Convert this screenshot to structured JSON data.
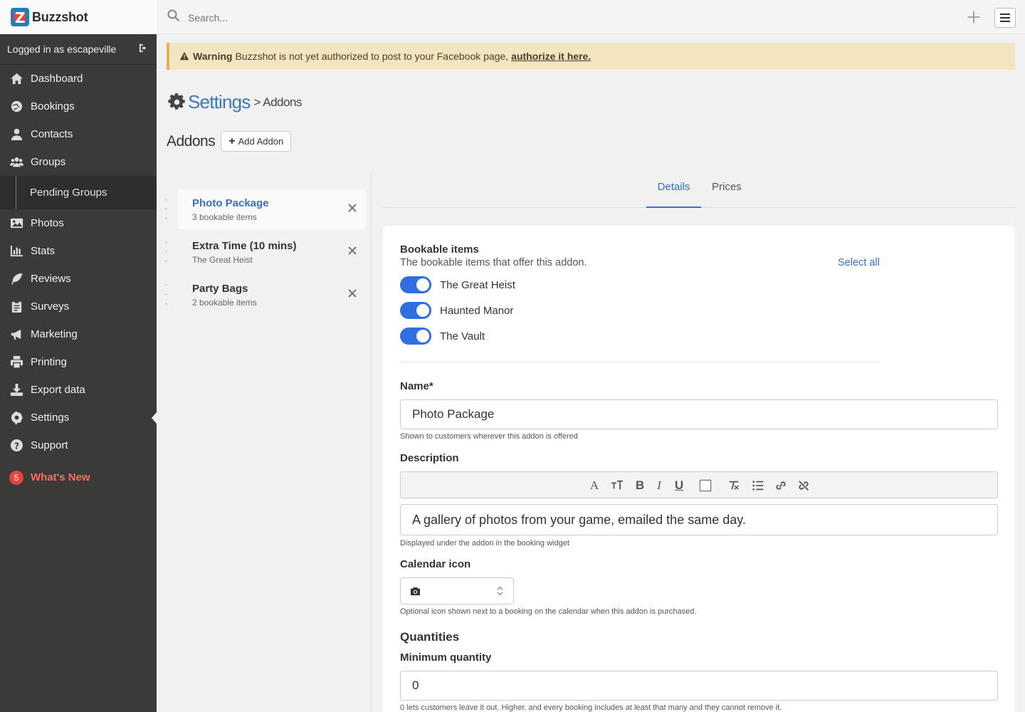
{
  "app": {
    "brand": "Buzzshot"
  },
  "search": {
    "placeholder": "Search..."
  },
  "sidebar": {
    "logged_in": "Logged in as escapeville",
    "items": [
      {
        "label": "Dashboard",
        "icon": "home-icon"
      },
      {
        "label": "Bookings",
        "icon": "globe-icon"
      },
      {
        "label": "Contacts",
        "icon": "user-icon"
      },
      {
        "label": "Groups",
        "icon": "users-icon"
      },
      {
        "label": "Pending Groups",
        "icon": ""
      },
      {
        "label": "Photos",
        "icon": "image-icon"
      },
      {
        "label": "Stats",
        "icon": "bar-chart-icon"
      },
      {
        "label": "Reviews",
        "icon": "feather-icon"
      },
      {
        "label": "Surveys",
        "icon": "clipboard-icon"
      },
      {
        "label": "Marketing",
        "icon": "megaphone-icon"
      },
      {
        "label": "Printing",
        "icon": "printer-icon"
      },
      {
        "label": "Export data",
        "icon": "download-icon"
      },
      {
        "label": "Settings",
        "icon": "gear-icon"
      },
      {
        "label": "Support",
        "icon": "question-icon"
      }
    ],
    "whats_new": {
      "label": "What's New",
      "count": "5"
    }
  },
  "warning": {
    "strong": "Warning",
    "text": "Buzzshot is not yet authorized to post to your Facebook page,",
    "link": "authorize it here."
  },
  "breadcrumb": {
    "section": "Settings",
    "current": "> Addons"
  },
  "addons": {
    "title": "Addons",
    "add_label": "Add Addon",
    "list": [
      {
        "name": "Photo Package",
        "sub": "3 bookable items",
        "selected": true
      },
      {
        "name": "Extra Time (10 mins)",
        "sub": "The Great Heist",
        "selected": false
      },
      {
        "name": "Party Bags",
        "sub": "2 bookable items",
        "selected": false
      }
    ]
  },
  "tabs": {
    "details": "Details",
    "prices": "Prices"
  },
  "form": {
    "bookable_title": "Bookable items",
    "bookable_desc": "The bookable items that offer this addon.",
    "select_all": "Select all",
    "bookables": [
      {
        "label": "The Great Heist",
        "on": true
      },
      {
        "label": "Haunted Manor",
        "on": true
      },
      {
        "label": "The Vault",
        "on": true
      }
    ],
    "name_label": "Name*",
    "name_value": "Photo Package",
    "name_hint": "Shown to customers wherever this addon is offered",
    "description_label": "Description",
    "description_value": "A gallery of photos from your game, emailed the same day.",
    "description_hint": "Displayed under the addon in the booking widget",
    "calendar_label": "Calendar icon",
    "calendar_icon": "camera-icon",
    "calendar_hint": "Optional icon shown next to a booking on the calendar when this addon is purchased.",
    "quantities_title": "Quantities",
    "min_label": "Minimum quantity",
    "min_value": "0",
    "min_hint": "0 lets customers leave it out. Higher, and every booking includes at least that many and they cannot remove it."
  },
  "colors": {
    "accent": "#3a6fc4",
    "toggle": "#2f6fe0",
    "sidebar": "#3b3a39",
    "warning_bg": "#f3e5bf",
    "badge": "#e8423e"
  }
}
